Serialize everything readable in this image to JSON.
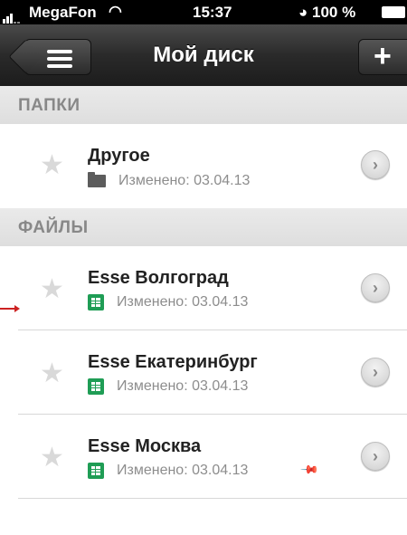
{
  "status_bar": {
    "carrier": "MegaFon",
    "time": "15:37",
    "battery": "100 %"
  },
  "nav": {
    "title": "Мой диск",
    "add_label": "+"
  },
  "sections": {
    "folders_label": "ПАПКИ",
    "files_label": "ФАЙЛЫ"
  },
  "folders": [
    {
      "name": "Другое",
      "modified": "Изменено: 03.04.13",
      "icon": "folder-icon"
    }
  ],
  "files": [
    {
      "name": "Esse Волгоград",
      "modified": "Изменено: 03.04.13",
      "icon": "spreadsheet-icon"
    },
    {
      "name": "Esse Екатеринбург",
      "modified": "Изменено: 03.04.13",
      "icon": "spreadsheet-icon"
    },
    {
      "name": "Esse Москва",
      "modified": "Изменено: 03.04.13",
      "icon": "spreadsheet-icon",
      "pinned": true
    }
  ],
  "colors": {
    "spreadsheet": "#1f9d55",
    "section_text": "#888888"
  }
}
